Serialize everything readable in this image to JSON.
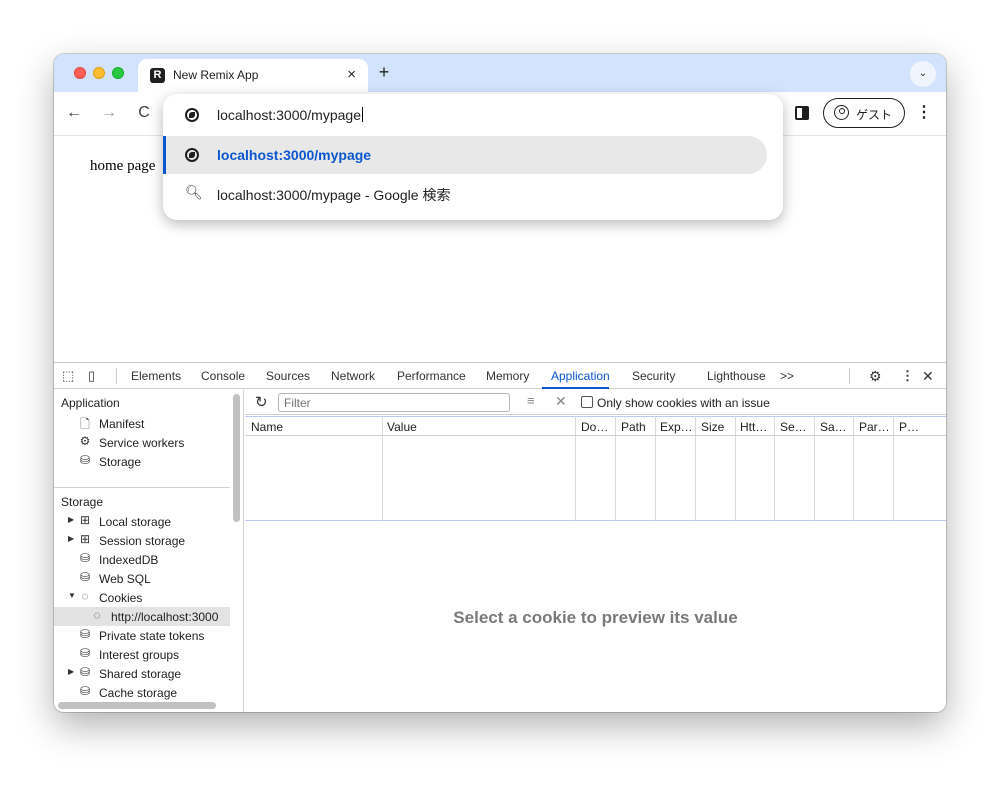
{
  "browser": {
    "tab": {
      "favicon": "R",
      "title": "New Remix App",
      "close": "×"
    },
    "new_tab_glyph": "+",
    "tab_search_glyph": "⌄",
    "profile_label": "ゲスト",
    "menu_glyph": "⋮"
  },
  "nav": {
    "back": "←",
    "forward": "→",
    "reload": "C"
  },
  "omnibox": {
    "input_value": "localhost:3000/mypage",
    "suggestions": [
      {
        "text": "localhost:3000/mypage",
        "icon": "globe-icon"
      },
      {
        "text": "localhost:3000/mypage - Google 検索",
        "icon": "search-icon"
      }
    ]
  },
  "page": {
    "text": "home page"
  },
  "devtools": {
    "tabs": [
      "Elements",
      "Console",
      "Sources",
      "Network",
      "Performance",
      "Memory",
      "Application",
      "Security",
      "Lighthouse"
    ],
    "active_tab": "Application",
    "more_tabs_glyph": ">>",
    "tree": {
      "application_heading": "Application",
      "application_items": [
        "Manifest",
        "Service workers",
        "Storage"
      ],
      "storage_heading": "Storage",
      "storage_items": [
        "Local storage",
        "Session storage",
        "IndexedDB",
        "Web SQL",
        "Cookies",
        "http://localhost:3000",
        "Private state tokens",
        "Interest groups",
        "Shared storage",
        "Cache storage"
      ]
    },
    "filter": {
      "placeholder": "Filter",
      "issue_label": "Only show cookies with an issue"
    },
    "columns": [
      "Name",
      "Value",
      "Do…",
      "Path",
      "Exp…",
      "Size",
      "Htt…",
      "Se…",
      "Sa…",
      "Par…",
      "P…"
    ],
    "preview_message": "Select a cookie to preview its value"
  },
  "colors": {
    "accent": "#0b57d0",
    "tabstrip": "#d3e3fd"
  }
}
